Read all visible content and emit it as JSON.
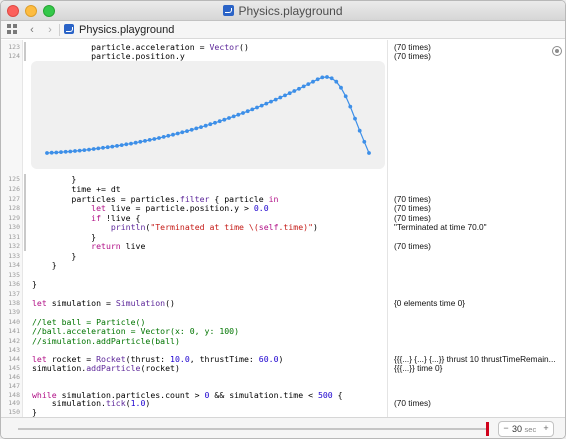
{
  "window": {
    "title": "Physics.playground"
  },
  "toolbar": {
    "breadcrumb": "Physics.playground"
  },
  "code_lines": [
    {
      "n": "123",
      "parts": [
        [
          "",
          "            particle.acceleration = "
        ],
        [
          "ty",
          "Vector"
        ],
        [
          "",
          "()"
        ]
      ],
      "result": "(70 times)"
    },
    {
      "n": "124",
      "parts": [
        [
          "",
          "            particle.position.y"
        ]
      ],
      "result": "(70 times)"
    },
    {
      "n": "125",
      "parts": [
        [
          "",
          "        }"
        ]
      ],
      "result": ""
    },
    {
      "n": "126",
      "parts": [
        [
          "",
          "        time += dt"
        ]
      ],
      "result": ""
    },
    {
      "n": "127",
      "parts": [
        [
          "",
          "        particles = particles."
        ],
        [
          "ty",
          "filter"
        ],
        [
          "",
          " { particle "
        ],
        [
          "kw",
          "in"
        ]
      ],
      "result": "(70 times)"
    },
    {
      "n": "128",
      "parts": [
        [
          "",
          "            "
        ],
        [
          "kw",
          "let"
        ],
        [
          "",
          " live = particle.position.y > "
        ],
        [
          "nu",
          "0.0"
        ]
      ],
      "result": "(70 times)"
    },
    {
      "n": "129",
      "parts": [
        [
          "",
          "            "
        ],
        [
          "kw",
          "if"
        ],
        [
          "",
          " !live {"
        ]
      ],
      "result": "(70 times)"
    },
    {
      "n": "130",
      "parts": [
        [
          "",
          "                "
        ],
        [
          "ty",
          "println"
        ],
        [
          "",
          "("
        ],
        [
          "st",
          "\"Terminated at time \\("
        ],
        [
          "kw",
          "self"
        ],
        [
          "st",
          ".time)\""
        ],
        [
          "",
          ")"
        ]
      ],
      "result": "\"Terminated at time 70.0\""
    },
    {
      "n": "131",
      "parts": [
        [
          "",
          "            }"
        ]
      ],
      "result": ""
    },
    {
      "n": "132",
      "parts": [
        [
          "",
          "            "
        ],
        [
          "kw",
          "return"
        ],
        [
          "",
          " live"
        ]
      ],
      "result": "(70 times)"
    },
    {
      "n": "133",
      "parts": [
        [
          "",
          "        }"
        ]
      ],
      "result": ""
    },
    {
      "n": "134",
      "parts": [
        [
          "",
          "    }"
        ]
      ],
      "result": ""
    },
    {
      "n": "135",
      "parts": [
        [
          "",
          ""
        ]
      ],
      "result": ""
    },
    {
      "n": "136",
      "parts": [
        [
          "",
          "}"
        ]
      ],
      "result": ""
    },
    {
      "n": "137",
      "parts": [
        [
          "",
          ""
        ]
      ],
      "result": ""
    },
    {
      "n": "138",
      "parts": [
        [
          "kw",
          "let"
        ],
        [
          "",
          " simulation = "
        ],
        [
          "ty",
          "Simulation"
        ],
        [
          "",
          "()"
        ]
      ],
      "result": "{0 elements time 0}"
    },
    {
      "n": "139",
      "parts": [
        [
          "",
          ""
        ]
      ],
      "result": ""
    },
    {
      "n": "140",
      "parts": [
        [
          "cm",
          "//let ball = Particle()"
        ]
      ],
      "result": ""
    },
    {
      "n": "141",
      "parts": [
        [
          "cm",
          "//ball.acceleration = Vector(x: 0, y: 100)"
        ]
      ],
      "result": ""
    },
    {
      "n": "142",
      "parts": [
        [
          "cm",
          "//simulation.addParticle(ball)"
        ]
      ],
      "result": ""
    },
    {
      "n": "143",
      "parts": [
        [
          "",
          ""
        ]
      ],
      "result": ""
    },
    {
      "n": "144",
      "parts": [
        [
          "kw",
          "let"
        ],
        [
          "",
          " rocket = "
        ],
        [
          "ty",
          "Rocket"
        ],
        [
          "",
          "(thrust: "
        ],
        [
          "nu",
          "10.0"
        ],
        [
          "",
          ", thrustTime: "
        ],
        [
          "nu",
          "60.0"
        ],
        [
          "",
          ")"
        ]
      ],
      "result": "{{{...} {...} {...}} thrust 10 thrustTimeRemain..."
    },
    {
      "n": "145",
      "parts": [
        [
          "",
          "simulation."
        ],
        [
          "ty",
          "addParticle"
        ],
        [
          "",
          "(rocket)"
        ]
      ],
      "result": "{{{...}} time 0}"
    },
    {
      "n": "146",
      "parts": [
        [
          "",
          ""
        ]
      ],
      "result": ""
    },
    {
      "n": "147",
      "parts": [
        [
          "",
          ""
        ]
      ],
      "result": ""
    },
    {
      "n": "148",
      "parts": [
        [
          "kw",
          "while"
        ],
        [
          "",
          " simulation.particles.count > "
        ],
        [
          "nu",
          "0"
        ],
        [
          "",
          " && simulation.time < "
        ],
        [
          "nu",
          "500"
        ],
        [
          "",
          " {"
        ]
      ],
      "result": ""
    },
    {
      "n": "149",
      "parts": [
        [
          "",
          "    simulation."
        ],
        [
          "ty",
          "tick"
        ],
        [
          "",
          "("
        ],
        [
          "nu",
          "1.0"
        ],
        [
          "",
          ")"
        ]
      ],
      "result": "(70 times)"
    },
    {
      "n": "150",
      "parts": [
        [
          "",
          "}"
        ]
      ],
      "result": ""
    }
  ],
  "chart_data": {
    "type": "line",
    "title": "",
    "xlabel": "",
    "ylabel": "",
    "series_color": "#3d8fe8",
    "x": [
      0,
      1,
      2,
      3,
      4,
      5,
      6,
      7,
      8,
      9,
      10,
      11,
      12,
      13,
      14,
      15,
      16,
      17,
      18,
      19,
      20,
      21,
      22,
      23,
      24,
      25,
      26,
      27,
      28,
      29,
      30,
      31,
      32,
      33,
      34,
      35,
      36,
      37,
      38,
      39,
      40,
      41,
      42,
      43,
      44,
      45,
      46,
      47,
      48,
      49,
      50,
      51,
      52,
      53,
      54,
      55,
      56,
      57,
      58,
      59,
      60,
      61,
      62,
      63,
      64,
      65,
      66,
      67,
      68,
      69
    ],
    "values": [
      0,
      0.3,
      0.6,
      1,
      1.4,
      1.8,
      2.3,
      2.8,
      3.4,
      4,
      4.6,
      5.3,
      6,
      6.7,
      7.5,
      8.3,
      9.2,
      10.1,
      11,
      12,
      13,
      14.1,
      15.2,
      16.3,
      17.5,
      18.7,
      20,
      21.3,
      22.7,
      24.1,
      25.5,
      27,
      28.6,
      30.2,
      31.8,
      33.5,
      35.2,
      37,
      38.8,
      40.7,
      42.6,
      44.6,
      46.6,
      48.7,
      50.8,
      53,
      55.2,
      57.5,
      59.8,
      62.2,
      64.6,
      67.1,
      69.6,
      72.2,
      74.8,
      77.5,
      80.2,
      83,
      85.8,
      88,
      88.5,
      87,
      83,
      76,
      66,
      54,
      40,
      26,
      13,
      0
    ]
  },
  "timeline": {
    "value": "30",
    "unit": "sec",
    "minus": "−",
    "plus": "+",
    "position_fraction": 0.997
  }
}
